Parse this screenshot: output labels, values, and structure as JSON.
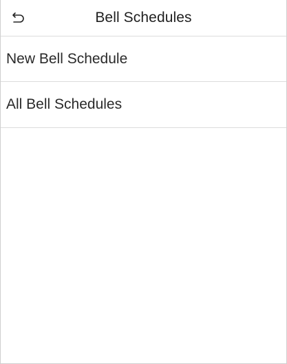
{
  "header": {
    "title": "Bell Schedules",
    "back_icon": "back-arrow-icon"
  },
  "menu": {
    "items": [
      {
        "label": "New Bell Schedule"
      },
      {
        "label": "All Bell Schedules"
      }
    ]
  },
  "colors": {
    "background": "#ffffff",
    "divider": "#dcdcdc",
    "text": "#2a2a2a"
  }
}
